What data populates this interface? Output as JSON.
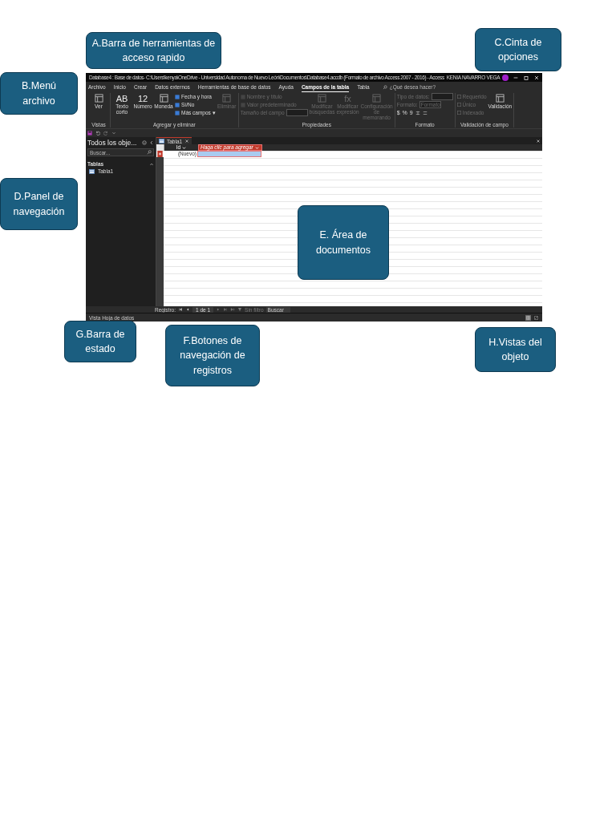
{
  "callouts": [
    {
      "label": "A.Barra de herramientas de acceso rapido"
    },
    {
      "label": "C.Cinta  de opciones"
    },
    {
      "label": "B.Menú archivo"
    },
    {
      "label": "D.Panel de navegación"
    },
    {
      "label": "E. Área de documentos"
    },
    {
      "label": "G.Barra de estado"
    },
    {
      "label": "F.Botones de navegación de registros"
    },
    {
      "label": "H.Vistas del objeto"
    }
  ],
  "window": {
    "title": "Database4 : Base de datos- C:\\Users\\kenya\\OneDrive - Universidad Autonoma de Nuevo León\\Documentos\\Database4.accdb (Formato de archivo Access 2007 - 2016) - Access",
    "user": "KENIA NAVARRO VEGA"
  },
  "menu_tabs": [
    {
      "label": "Archivo",
      "selected": false
    },
    {
      "label": "Inicio",
      "selected": false
    },
    {
      "label": "Crear",
      "selected": false
    },
    {
      "label": "Datos externos",
      "selected": false
    },
    {
      "label": "Herramientas de base de datos",
      "selected": false
    },
    {
      "label": "Ayuda",
      "selected": false
    },
    {
      "label": "Campos de la tabla",
      "selected": true
    },
    {
      "label": "Tabla",
      "selected": false
    }
  ],
  "tell_me": {
    "placeholder": "¿Qué desea hacer?"
  },
  "ribbon_groups": [
    {
      "name": "Vistas",
      "columns": [
        [
          {
            "kind": "large",
            "label": "Ver",
            "disabled": false
          }
        ]
      ]
    },
    {
      "name": "Agregar y eliminar",
      "columns": [
        [
          {
            "kind": "large",
            "glyph": "AB",
            "label": "Texto corto",
            "disabled": false
          }
        ],
        [
          {
            "kind": "large",
            "glyph": "12",
            "label": "Número",
            "disabled": false
          }
        ],
        [
          {
            "kind": "large",
            "label": "Moneda",
            "disabled": false
          }
        ],
        [
          {
            "kind": "small",
            "label": "Fecha y hora",
            "disabled": false
          },
          {
            "kind": "small",
            "label": "Sí/No",
            "disabled": false
          },
          {
            "kind": "small",
            "label": "Más campos ▾",
            "disabled": false
          }
        ],
        [
          {
            "kind": "large",
            "label": "Eliminar",
            "disabled": true
          }
        ]
      ]
    },
    {
      "name": "Propiedades",
      "columns": [
        [
          {
            "kind": "small",
            "label": "Nombre y título",
            "disabled": true
          },
          {
            "kind": "small",
            "label": "Valor predeterminado",
            "disabled": true
          },
          {
            "kind": "field",
            "label": "Tamaño del campo",
            "disabled": true
          }
        ],
        [
          {
            "kind": "large",
            "label": "Modificar búsquedas",
            "disabled": true
          }
        ],
        [
          {
            "kind": "large",
            "glyph": "fx",
            "label": "Modificar expresión",
            "disabled": true
          }
        ],
        [
          {
            "kind": "large",
            "label": "Configuración de memorando",
            "disabled": true
          }
        ]
      ]
    },
    {
      "name": "Formato",
      "columns": [
        [
          {
            "kind": "field",
            "label": "Tipo de datos:",
            "disabled": true
          },
          {
            "kind": "field",
            "label": "Formato:",
            "value": "Formato",
            "disabled": true
          },
          {
            "kind": "formats",
            "glyphs": [
              "$",
              "%",
              "9"
            ],
            "disabled": false
          }
        ]
      ]
    },
    {
      "name": "Validación de campo",
      "columns": [
        [
          {
            "kind": "check",
            "label": "Requerido",
            "checked": false,
            "disabled": true
          },
          {
            "kind": "check",
            "label": "Único",
            "checked": false,
            "disabled": true
          },
          {
            "kind": "check",
            "label": "Indexado",
            "checked": false,
            "disabled": true
          }
        ],
        [
          {
            "kind": "large",
            "label": "Validación",
            "disabled": false
          }
        ]
      ]
    }
  ],
  "nav_pane": {
    "title": "Todos los obje...",
    "search_placeholder": "Buscar...",
    "section": "Tablas",
    "items": [
      {
        "label": "Tabla1"
      }
    ]
  },
  "document": {
    "tab": "Tabla1",
    "columns": [
      {
        "label": "Id",
        "kind": "field"
      },
      {
        "label": "Haga clic para agregar",
        "kind": "add"
      }
    ],
    "new_row": "(Nuevo)"
  },
  "record_nav": {
    "label": "Registro:",
    "position": "1 de 1",
    "filter": "Sin filtro",
    "search": "Buscar"
  },
  "status_bar": {
    "text": "Vista Hoja de datos",
    "views": [
      {
        "selected": true
      },
      {
        "selected": false
      }
    ]
  }
}
